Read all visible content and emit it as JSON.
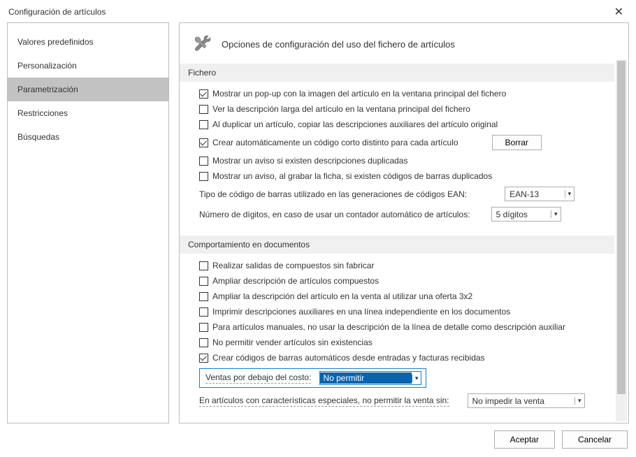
{
  "window": {
    "title": "Configuración de artículos",
    "close_glyph": "✕"
  },
  "sidebar": {
    "items": [
      {
        "label": "Valores predefinidos"
      },
      {
        "label": "Personalización"
      },
      {
        "label": "Parametrización"
      },
      {
        "label": "Restricciones"
      },
      {
        "label": "Búsquedas"
      }
    ],
    "selected_index": 2
  },
  "header": {
    "title": "Opciones de configuración del uso del fichero de artículos"
  },
  "sections": {
    "fichero": {
      "title": "Fichero",
      "popup_imagen": {
        "checked": true,
        "label": "Mostrar un pop-up con la imagen del artículo en la ventana principal del fichero"
      },
      "desc_larga": {
        "checked": false,
        "label": "Ver la descripción larga del artículo en la ventana principal del fichero"
      },
      "duplicar_copiar": {
        "checked": false,
        "label": "Al duplicar un artículo, copiar las descripciones auxiliares del artículo original"
      },
      "codigo_corto": {
        "checked": true,
        "label": "Crear automáticamente un código corto distinto para cada artículo"
      },
      "borrar_btn": "Borrar",
      "aviso_duplicadas": {
        "checked": false,
        "label": "Mostrar un aviso si existen descripciones duplicadas"
      },
      "aviso_barras": {
        "checked": false,
        "label": "Mostrar un aviso, al grabar la ficha, si existen códigos de barras duplicados"
      },
      "tipo_barras_label": "Tipo de código de barras utilizado en las generaciones de códigos EAN:",
      "tipo_barras_value": "EAN-13",
      "num_digitos_label": "Número de dígitos, en caso de usar un contador automático de artículos:",
      "num_digitos_value": "5 dígitos"
    },
    "comportamiento": {
      "title": "Comportamiento en documentos",
      "salidas_compuestos": {
        "checked": false,
        "label": "Realizar salidas de compuestos sin fabricar"
      },
      "ampliar_desc_comp": {
        "checked": false,
        "label": "Ampliar descripción de artículos compuestos"
      },
      "ampliar_desc_oferta": {
        "checked": false,
        "label": "Ampliar la descripción del artículo en la venta al utilizar una oferta 3x2"
      },
      "imprimir_aux": {
        "checked": false,
        "label": "Imprimir descripciones auxiliares en una línea independiente en los documentos"
      },
      "manuales_desc": {
        "checked": false,
        "label": "Para artículos manuales, no usar la descripción de la línea de detalle como descripción auxiliar"
      },
      "no_permitir_sin_exist": {
        "checked": false,
        "label": "No permitir vender artículos sin existencias"
      },
      "crear_barras_auto": {
        "checked": true,
        "label": "Crear códigos de barras automáticos desde entradas y facturas recibidas"
      },
      "ventas_bajo_costo_label": "Ventas por debajo del costo:",
      "ventas_bajo_costo_value": "No permitir",
      "caract_especiales_label": "En artículos con características especiales, no permitir la venta sin:",
      "caract_especiales_value": "No impedir la venta"
    }
  },
  "footer": {
    "accept": "Aceptar",
    "cancel": "Cancelar"
  }
}
